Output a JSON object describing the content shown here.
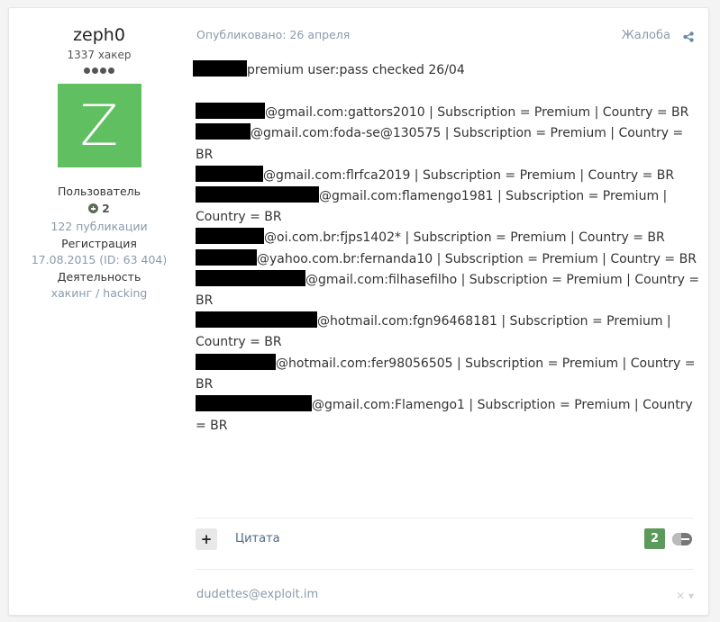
{
  "author": {
    "name": "zeph0",
    "rank_title": "1337 хакер",
    "rank_pips": 4,
    "avatar_letter": "Z",
    "avatar_color": "#5fbf61",
    "group": "Пользователь",
    "reputation": "2",
    "posts": "122 публикации",
    "registration_label": "Регистрация",
    "registration_value": "17.08.2015 (ID: 63 404)",
    "activity_label": "Деятельность",
    "activity_value": "хакинг / hacking"
  },
  "post": {
    "published": "Опубликовано: 26 апреля",
    "report_label": "Жалоба",
    "headline": "premium user:pass checked 26/04",
    "entries": [
      {
        "text": "@gmail.com:gattors2010 | Subscription = Premium | Country = BR"
      },
      {
        "text": "@gmail.com:foda-se@130575 | Subscription = Premium | Country = BR"
      },
      {
        "text": "@gmail.com:flrfca2019 | Subscription = Premium | Country = BR"
      },
      {
        "text": "@gmail.com:flamengo1981 | Subscription = Premium | Country = BR"
      },
      {
        "text": "@oi.com.br:fjps1402* | Subscription = Premium | Country = BR"
      },
      {
        "text": "@yahoo.com.br:fernanda10 | Subscription = Premium | Country = BR"
      },
      {
        "text": "@gmail.com:filhasefilho | Subscription = Premium | Country = BR"
      },
      {
        "text": "@hotmail.com:fgn96468181 | Subscription = Premium | Country = BR"
      },
      {
        "text": "@hotmail.com:fer98056505 | Subscription = Premium | Country = BR"
      },
      {
        "text": "@gmail.com:Flamengo1 | Subscription = Premium | Country = BR"
      }
    ],
    "quote_plus": "+",
    "quote_label": "Цитата",
    "reaction_count": "2",
    "signature": "dudettes@exploit.im",
    "signature_controls": "✕ ▾"
  }
}
